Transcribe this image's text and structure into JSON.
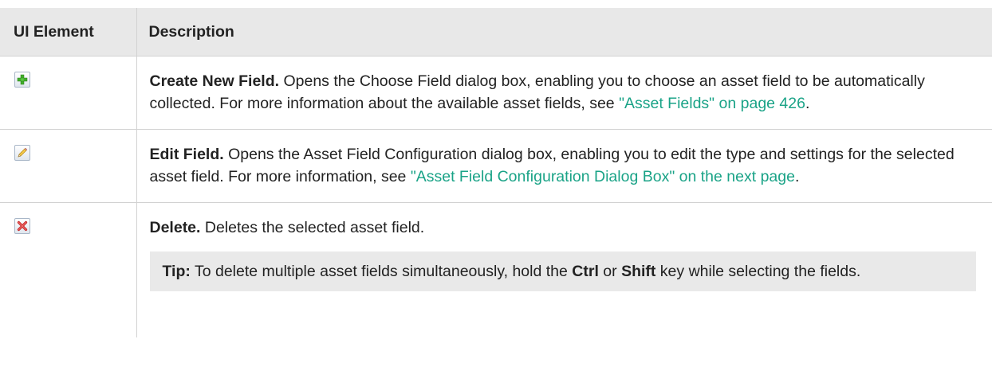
{
  "header": {
    "ui_element": "UI Element",
    "description": "Description"
  },
  "rows": [
    {
      "icon": "add-field-icon",
      "title": "Create New Field.",
      "text": " Opens the Choose Field dialog box, enabling you to choose an asset field to be automatically collected. For more information about the available asset fields, see ",
      "link": "\"Asset Fields\" on page 426",
      "end": "."
    },
    {
      "icon": "edit-pencil-icon",
      "title": "Edit Field.",
      "text": " Opens the Asset Field Configuration dialog box, enabling you to edit the type and settings for the selected asset field. For more information, see ",
      "link": "\"Asset Field Configuration Dialog Box\" on the next page",
      "end": "."
    },
    {
      "icon": "delete-x-icon",
      "title": "Delete.",
      "text": " Deletes the selected asset field.",
      "tip": {
        "label": "Tip:",
        "part1": " To delete multiple asset fields simultaneously, hold the ",
        "key1": "Ctrl",
        "part2": " or ",
        "key2": "Shift",
        "part3": " key while selecting the fields."
      }
    }
  ],
  "colors": {
    "header_bg": "#e8e8e8",
    "link": "#1aa387",
    "tip_bg": "#e9e9e9",
    "border": "#d2d2d2"
  }
}
